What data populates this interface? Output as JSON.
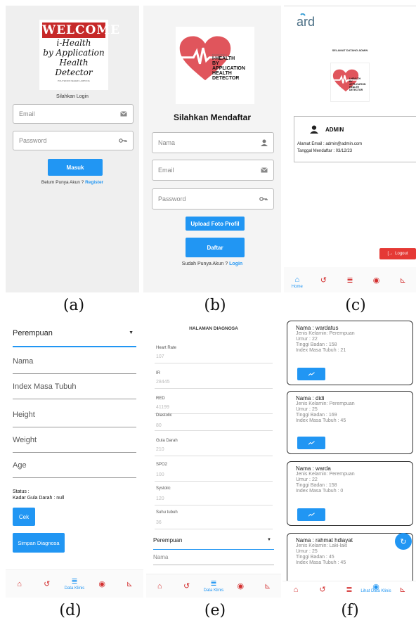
{
  "captions": [
    "(a)",
    "(b)",
    "(c)",
    "(d)",
    "(e)",
    "(f)"
  ],
  "a": {
    "logo": {
      "title": "WELCOME",
      "line1": "i-Health",
      "line2": "by Application",
      "line3": "Health Detector",
      "small": "POLITEKNIK NEGERI LAMPUNG"
    },
    "subtitle": "Silahkan Login",
    "email_placeholder": "Email",
    "password_placeholder": "Password",
    "login_button": "Masuk",
    "register_prompt": "Belum Punya Akun ?",
    "register_link": "Register"
  },
  "b": {
    "logo": {
      "line0": "Final Portfolio 1",
      "line1": "I-HEALTH",
      "line2": "BY",
      "line3": "APPLICATION",
      "line4": "HEALTH",
      "line5": "DETECTOR"
    },
    "title": "Silahkan Mendaftar",
    "name_placeholder": "Nama",
    "email_placeholder": "Email",
    "password_placeholder": "Password",
    "upload_button": "Upload Foto Profil",
    "register_button": "Daftar",
    "login_prompt": "Sudah Punya Akun ?",
    "login_link": "Login"
  },
  "c": {
    "welcome": "SELAMAT DATANG ADMIN",
    "logo": {
      "line1": "I-HEALTH",
      "line2": "BY",
      "line3": "APPLICATION",
      "line4": "HEALTH",
      "line5": "DETECTOR"
    },
    "role": "ADMIN",
    "email_line": "Alamat Email : admin@admin.com",
    "date_line": "Tanggal Mendaftar  : 03/12/23",
    "logout_button": "Logout",
    "nav_home_label": "Home"
  },
  "d": {
    "gender_select": "Perempuan",
    "fields": [
      "Nama",
      "Index Masa Tubuh",
      "Height",
      "Weight",
      "Age"
    ],
    "status_label": "Status :",
    "status_value": "Kadar Gula Darah : null",
    "check_button": "Cek",
    "save_button": "Simpan Diagnosa",
    "nav_label": "Data Klinis"
  },
  "e": {
    "title": "HALAMAN DIAGNOSA",
    "rows": [
      {
        "label": "Heart Rate",
        "value": "107"
      },
      {
        "label": "IR",
        "value": "28445"
      },
      {
        "label": "RED",
        "value": "41199"
      },
      {
        "label": "Diastolic",
        "value": "80"
      },
      {
        "label": "Gula Darah",
        "value": "210"
      },
      {
        "label": "SPO2",
        "value": "100"
      },
      {
        "label": "Systolic",
        "value": "120"
      },
      {
        "label": "Suhu tubuh",
        "value": "36"
      }
    ],
    "gender_select": "Perempuan",
    "name_field": "Nama",
    "nav_label": "Data Klinis"
  },
  "f": {
    "cards": [
      {
        "name": "Nama : wardatus",
        "gender": "Jenis Kelamin: Perempuan",
        "age": "Umur : 22",
        "height": "Tinggi Badan : 158",
        "bmi": "Index Masa Tubuh : 21"
      },
      {
        "name": "Nama : didi",
        "gender": "Jenis Kelamin: Perempuan",
        "age": "Umur : 25",
        "height": "Tinggi Badan : 169",
        "bmi": "Index Masa Tubuh : 45"
      },
      {
        "name": "Nama : warda",
        "gender": "Jenis Kelamin: Perempuan",
        "age": "Umur : 22",
        "height": "Tinggi Badan : 158",
        "bmi": "Index Masa Tubuh : 0"
      },
      {
        "name": "Nama : rahmat hdiayat",
        "gender": "Jenis Kelamin: Laki-laki",
        "age": "Umur : 25",
        "height": "Tinggi Badan : 45",
        "bmi": "Index Masa Tubuh : 45"
      }
    ],
    "nav_label": "Lihat Data Klinis"
  },
  "colors": {
    "accent": "#2196f3",
    "nav_icon": "#d32f2f",
    "logout": "#e53935",
    "heart": "#e0555c"
  }
}
